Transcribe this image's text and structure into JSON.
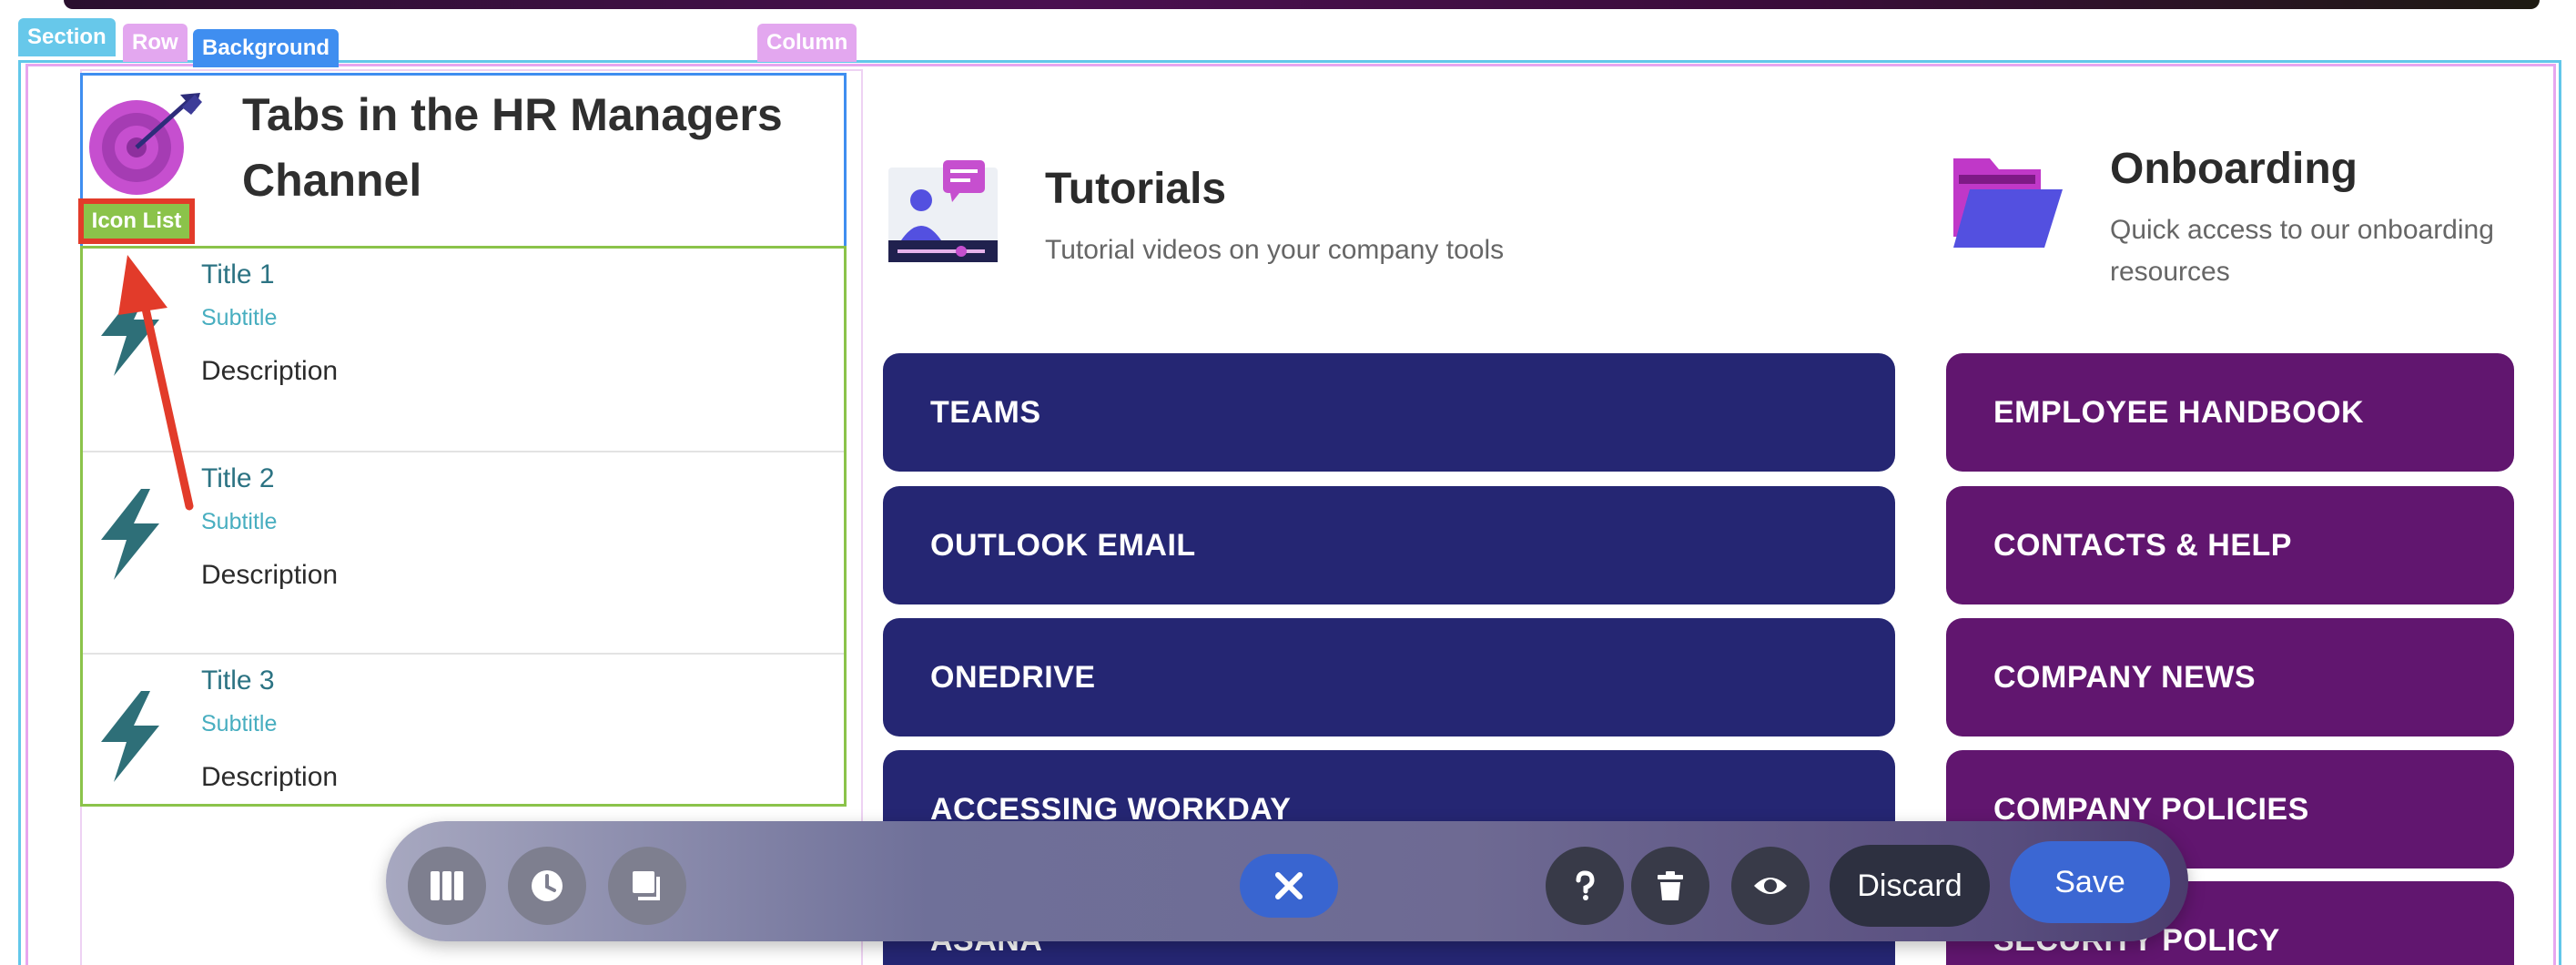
{
  "editor": {
    "tags": {
      "section": "Section",
      "row": "Row",
      "background": "Background",
      "column": "Column",
      "icon_list": "Icon List"
    }
  },
  "hr_header": {
    "title": "Tabs in the HR Managers Channel",
    "icon": "target-arrow-icon"
  },
  "icon_list": {
    "items": [
      {
        "title": "Title 1",
        "subtitle": "Subtitle",
        "description": "Description",
        "icon": "lightning-bolt-icon"
      },
      {
        "title": "Title 2",
        "subtitle": "Subtitle",
        "description": "Description",
        "icon": "lightning-bolt-icon"
      },
      {
        "title": "Title 3",
        "subtitle": "Subtitle",
        "description": "Description",
        "icon": "lightning-bolt-icon"
      }
    ]
  },
  "tutorials": {
    "title": "Tutorials",
    "subtitle": "Tutorial videos on your company tools",
    "icon": "video-tutorial-icon",
    "links": [
      "TEAMS",
      "OUTLOOK EMAIL",
      "ONEDRIVE",
      "ACCESSING WORKDAY",
      "ASANA"
    ]
  },
  "onboarding": {
    "title": "Onboarding",
    "subtitle": "Quick access to our onboarding resources",
    "icon": "folder-icon",
    "links": [
      "EMPLOYEE HANDBOOK",
      "CONTACTS & HELP",
      "COMPANY NEWS",
      "COMPANY POLICIES",
      "SECURITY POLICY"
    ]
  },
  "toolbar": {
    "discard_label": "Discard",
    "save_label": "Save"
  },
  "colors": {
    "navy": "#252673",
    "purple": "#61166f",
    "teal": "#2c7383",
    "accent_blue": "#3b67d3",
    "icon_list_green": "#8bc34a",
    "annotation_red": "#e23b2a"
  }
}
